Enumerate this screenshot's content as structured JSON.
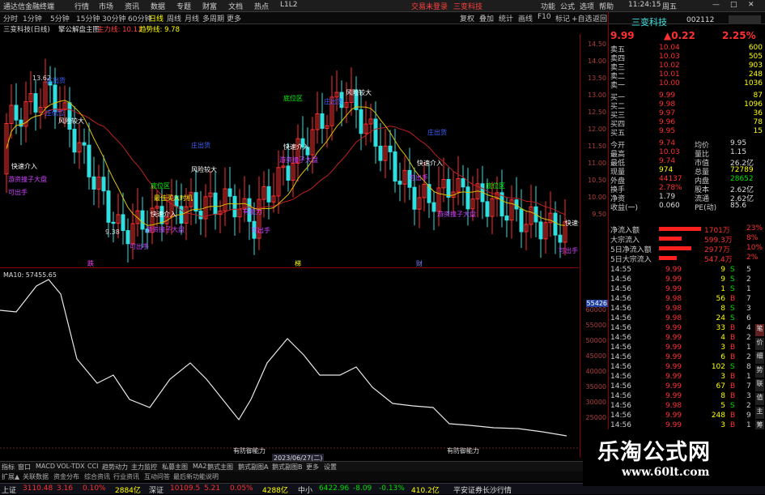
{
  "menubar": {
    "app_title": "通达信金融终端",
    "items": [
      "行情",
      "市场",
      "资讯",
      "数据",
      "专题",
      "财富",
      "文档",
      "热点",
      "L1L2"
    ],
    "center_items": [
      "交易未登录",
      "三变科技"
    ],
    "right_items": [
      "功能",
      "公式",
      "选项",
      "帮助"
    ],
    "time": "11:24:15",
    "tab": "周五"
  },
  "toolbar": {
    "periods": [
      "分时",
      "1分钟",
      "5分钟",
      "15分钟",
      "30分钟",
      "60分钟",
      "日线",
      "周线",
      "月线",
      "多周期",
      "更多"
    ],
    "active_period": "日线",
    "right_buttons": [
      "复权",
      "叠加",
      "统计",
      "画线",
      "F10",
      "标记",
      "+自选",
      "返回"
    ]
  },
  "chart_info": {
    "name": "三变科技(日线)",
    "indicator": "擎公解盘主图",
    "param1": "主力线: 10.11",
    "param2": "趋势线: 9.78"
  },
  "y_axis": {
    "main_labels": [
      "14.50",
      "14.00",
      "13.50",
      "13.00",
      "12.50",
      "12.00",
      "11.50",
      "11.00",
      "10.50",
      "10.00",
      "9.50"
    ],
    "sub_labels": [
      "60000",
      "55000",
      "50000",
      "45000",
      "40000",
      "35000",
      "30000",
      "25000",
      "20000",
      "15000",
      "10000"
    ],
    "sub_current": "55426"
  },
  "annotations": {
    "high": "13.62",
    "low": "9.38",
    "labels": [
      {
        "text": "风险较大",
        "color": "#ffffff"
      },
      {
        "text": "风险较大",
        "color": "#ffffff"
      },
      {
        "text": "风险较大",
        "color": "#ffffff"
      },
      {
        "text": "快速介入",
        "color": "#ffffff"
      },
      {
        "text": "快速介入",
        "color": "#ffffff"
      },
      {
        "text": "快速介入",
        "color": "#ffffff"
      },
      {
        "text": "快速介入",
        "color": "#ffffff"
      },
      {
        "text": "快速介入",
        "color": "#ffffff"
      },
      {
        "text": "庄出货",
        "color": "#4060ff"
      },
      {
        "text": "庄出货",
        "color": "#4060ff"
      },
      {
        "text": "庄出货",
        "color": "#4060ff"
      },
      {
        "text": "庄出货",
        "color": "#4060ff"
      },
      {
        "text": "游资撞子大盘",
        "color": "#d040ff"
      },
      {
        "text": "游资撞子大盘",
        "color": "#d040ff"
      },
      {
        "text": "游资撞子大盘",
        "color": "#d040ff"
      },
      {
        "text": "游资撞子大盘",
        "color": "#d040ff"
      },
      {
        "text": "可出手",
        "color": "#d040ff"
      },
      {
        "text": "可出手",
        "color": "#d040ff"
      },
      {
        "text": "可出手",
        "color": "#d040ff"
      },
      {
        "text": "可出手",
        "color": "#d040ff"
      },
      {
        "text": "可出手",
        "color": "#d040ff"
      },
      {
        "text": "有能力",
        "color": "#d040ff"
      },
      {
        "text": "最佳买入时机",
        "color": "#ffff00"
      },
      {
        "text": "底位区",
        "color": "#00ff00"
      },
      {
        "text": "底位区",
        "color": "#00ff00"
      },
      {
        "text": "底位区",
        "color": "#00ff00"
      },
      {
        "text": "庄低位",
        "color": "#4060ff"
      }
    ],
    "markers": [
      "跌",
      "梯",
      "财"
    ]
  },
  "sub_chart": {
    "title": "MA10: 57455.65",
    "marks": [
      "有防御能力",
      "有防御能力"
    ],
    "date_label": "2023/06/27(二)"
  },
  "quote": {
    "name": "三变科技",
    "code": "002112",
    "price": "9.99",
    "change": "▲0.22",
    "pct": "2.25%",
    "asks": [
      {
        "label": "卖五",
        "price": "10.04",
        "vol": "600"
      },
      {
        "label": "卖四",
        "price": "10.03",
        "vol": "505"
      },
      {
        "label": "卖三",
        "price": "10.02",
        "vol": "903"
      },
      {
        "label": "卖二",
        "price": "10.01",
        "vol": "248"
      },
      {
        "label": "卖一",
        "price": "10.00",
        "vol": "1036"
      }
    ],
    "bids": [
      {
        "label": "买一",
        "price": "9.99",
        "vol": "87"
      },
      {
        "label": "买二",
        "price": "9.98",
        "vol": "1096"
      },
      {
        "label": "买三",
        "price": "9.97",
        "vol": "36"
      },
      {
        "label": "买四",
        "price": "9.96",
        "vol": "78"
      },
      {
        "label": "买五",
        "price": "9.95",
        "vol": "15"
      }
    ],
    "stats": [
      {
        "l1": "今开",
        "v1": "9.74",
        "l2": "均价",
        "v2": "9.95"
      },
      {
        "l1": "最高",
        "v1": "10.03",
        "l2": "量比",
        "v2": "1.15"
      },
      {
        "l1": "最低",
        "v1": "9.74",
        "l2": "市值",
        "v2": "26.2亿"
      },
      {
        "l1": "现量",
        "v1": "974",
        "l2": "总量",
        "v2": "72789"
      },
      {
        "l1": "外盘",
        "v1": "44137",
        "l2": "内盘",
        "v2": "28652"
      },
      {
        "l1": "换手",
        "v1": "2.78%",
        "l2": "股本",
        "v2": "2.62亿"
      },
      {
        "l1": "净资",
        "v1": "1.79",
        "l2": "流通",
        "v2": "2.62亿"
      },
      {
        "l1": "收益(一)",
        "v1": "0.060",
        "l2": "PE(动)",
        "v2": "85.6"
      }
    ],
    "flows": [
      {
        "label": "净流入额",
        "value": "1701万",
        "pct": "23%"
      },
      {
        "label": "大宗流入",
        "value": "599.3万",
        "pct": "8%"
      },
      {
        "label": "5日净流入额",
        "value": "2977万",
        "pct": "10%"
      },
      {
        "label": "5日大宗流入",
        "value": "547.4万",
        "pct": "2%"
      }
    ],
    "ticks": [
      {
        "t": "14:55",
        "p": "9.99",
        "v": "9",
        "s": "S",
        "n": "5"
      },
      {
        "t": "14:56",
        "p": "9.99",
        "v": "9",
        "s": "S",
        "n": "2"
      },
      {
        "t": "14:56",
        "p": "9.99",
        "v": "1",
        "s": "S",
        "n": "1"
      },
      {
        "t": "14:56",
        "p": "9.98",
        "v": "56",
        "s": "B",
        "n": "7"
      },
      {
        "t": "14:56",
        "p": "9.98",
        "v": "8",
        "s": "S",
        "n": "3"
      },
      {
        "t": "14:56",
        "p": "9.98",
        "v": "24",
        "s": "S",
        "n": "6"
      },
      {
        "t": "14:56",
        "p": "9.99",
        "v": "33",
        "s": "B",
        "n": "4"
      },
      {
        "t": "14:56",
        "p": "9.99",
        "v": "4",
        "s": "B",
        "n": "2"
      },
      {
        "t": "14:56",
        "p": "9.99",
        "v": "3",
        "s": "B",
        "n": "1"
      },
      {
        "t": "14:56",
        "p": "9.99",
        "v": "6",
        "s": "B",
        "n": "2"
      },
      {
        "t": "14:56",
        "p": "9.99",
        "v": "102",
        "s": "S",
        "n": "8"
      },
      {
        "t": "14:56",
        "p": "9.99",
        "v": "3",
        "s": "B",
        "n": "1"
      },
      {
        "t": "14:56",
        "p": "9.99",
        "v": "67",
        "s": "B",
        "n": "7"
      },
      {
        "t": "14:56",
        "p": "9.99",
        "v": "8",
        "s": "B",
        "n": "3"
      },
      {
        "t": "14:56",
        "p": "9.98",
        "v": "5",
        "s": "S",
        "n": "2"
      },
      {
        "t": "14:56",
        "p": "9.99",
        "v": "248",
        "s": "B",
        "n": "9"
      },
      {
        "t": "14:56",
        "p": "9.99",
        "v": "3",
        "s": "B",
        "n": "1"
      }
    ],
    "tabs": [
      "笔",
      "价",
      "细",
      "势",
      "联",
      "值",
      "主",
      "筹"
    ]
  },
  "bottom_tabs": [
    "指标",
    "窗口",
    "MACD",
    "VOL-TDX",
    "CCI",
    "趋势动力",
    "主力监控",
    "私募主图",
    "MA2",
    "鹅式主图",
    "鹅式副图A",
    "鹅式副图B",
    "更多",
    "设置"
  ],
  "bottom_tabs2": [
    "扩展▲",
    "关联数据",
    "资金分布",
    "综合资讯",
    "行业资讯",
    "互动问答",
    "最后新功能说明"
  ],
  "status": {
    "items": [
      {
        "label": "上证",
        "value": "3110.48",
        "chg": "3.16",
        "pct": "0.10%",
        "amt": "2884亿"
      },
      {
        "label": "深证",
        "value": "10109.5",
        "chg": "5.21",
        "pct": "0.05%",
        "amt": "4288亿"
      },
      {
        "label": "中小",
        "value": "6422.96",
        "chg": "-8.09",
        "pct": "-0.13%",
        "amt": "410.2亿"
      }
    ],
    "broker": "平安证券长沙行情"
  },
  "watermark": {
    "line1": "乐淘公式网",
    "line2": "www.60lt.com"
  },
  "colors": {
    "up": "#ff3030",
    "down": "#00e0e0",
    "bg": "#000000",
    "grid": "#8b0000",
    "yellow": "#ffff00",
    "white": "#ffffff"
  }
}
